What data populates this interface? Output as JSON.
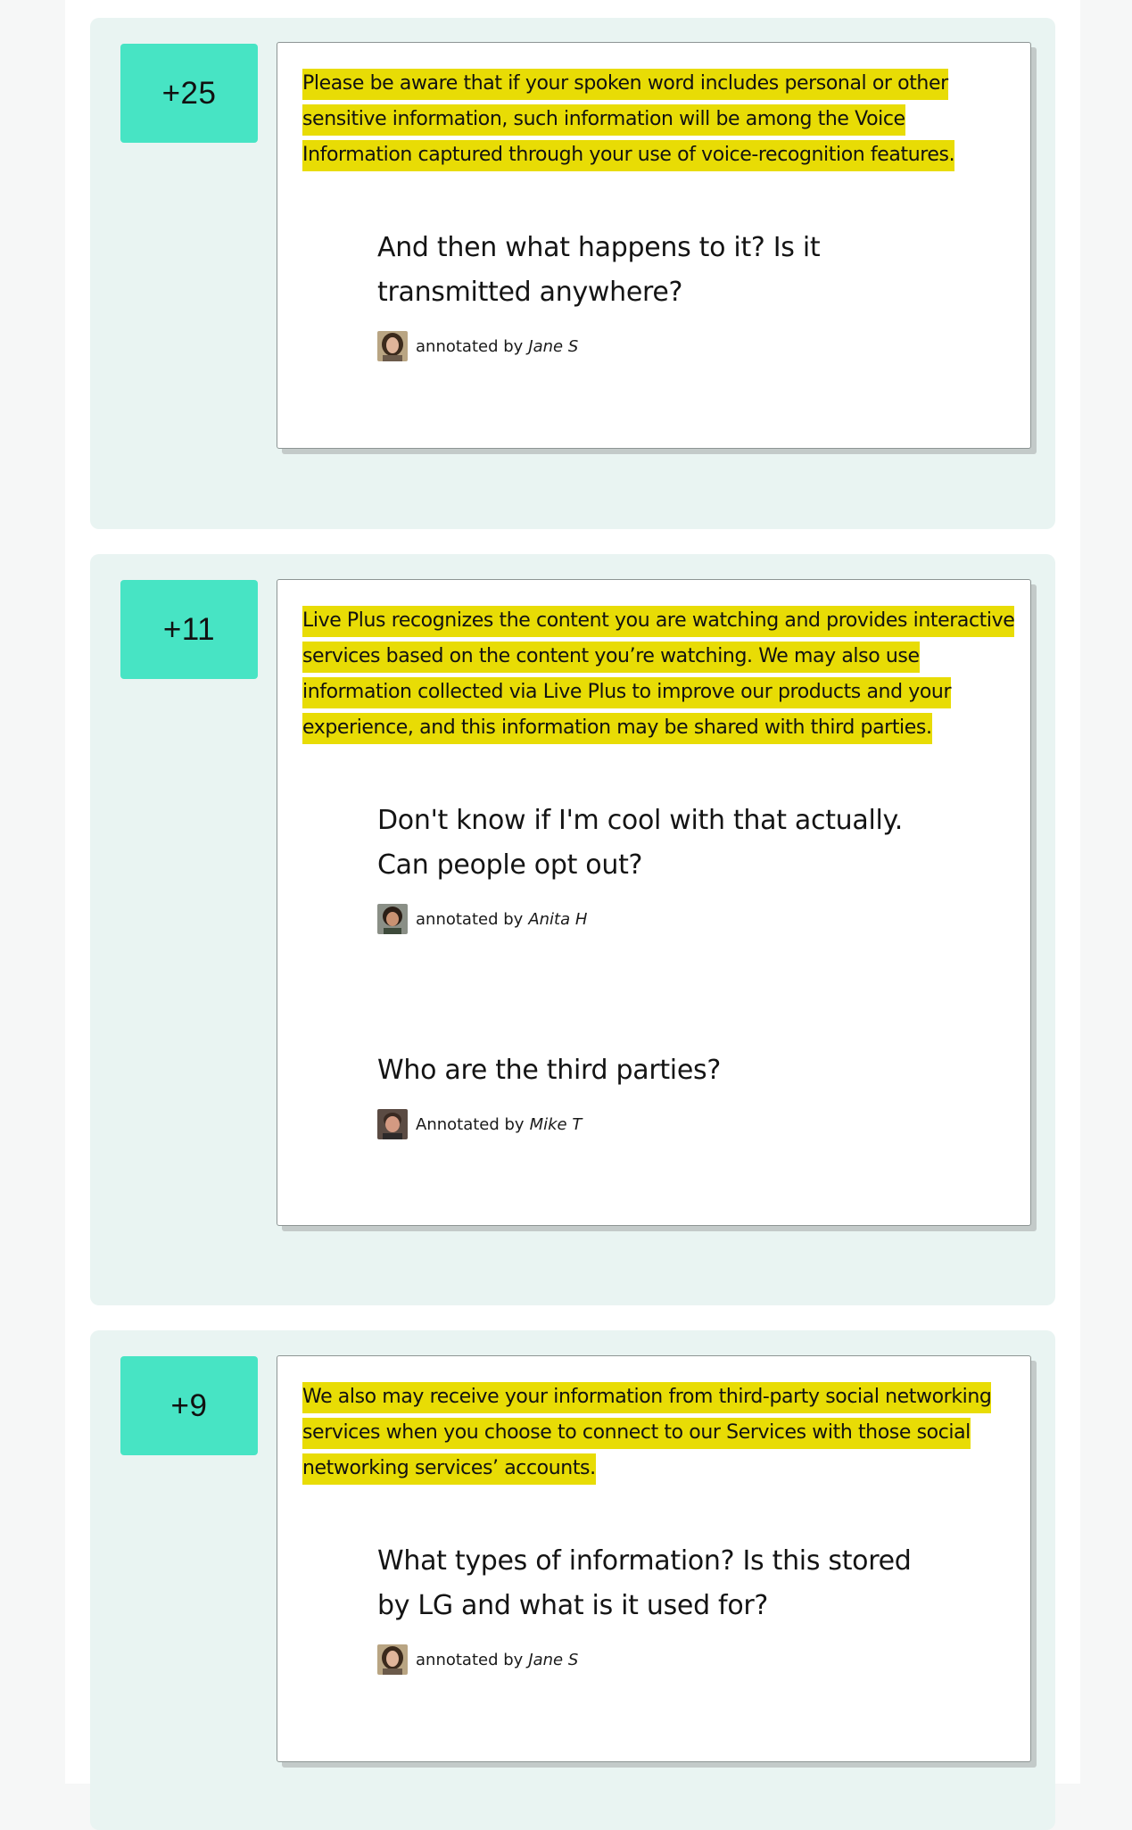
{
  "annotations": [
    {
      "score": "+25",
      "quote": "Please be aware that if your spoken word includes personal or other sensitive information, such information will be among the Voice Information captured through your use of voice-recognition features.",
      "notes": [
        {
          "text": "And then what happens to it? Is it transmitted anywhere?",
          "by_label": "annotated by",
          "author": "Jane S",
          "avatar": "avatar-jane"
        }
      ]
    },
    {
      "score": "+11",
      "quote": "Live Plus recognizes the content you are watching and provides interactive services based on the content you’re watching. We may also use information collected via Live Plus to improve our products and your experience, and this information may be shared with third parties.",
      "notes": [
        {
          "text": "Don't know if I'm cool with that actually. Can people opt out?",
          "by_label": "annotated by",
          "author": "Anita H",
          "avatar": "avatar-anita"
        },
        {
          "text": "Who are the third parties?",
          "by_label": "Annotated by",
          "author": "Mike T",
          "avatar": "avatar-mike"
        }
      ]
    },
    {
      "score": "+9",
      "quote": "We also may receive your information from third-party social networking services when you choose to connect to our Services with those social networking services’ accounts.",
      "notes": [
        {
          "text": "What types of information? Is this stored by LG and what is it used for?",
          "by_label": "annotated by",
          "author": "Jane S",
          "avatar": "avatar-jane"
        }
      ]
    }
  ],
  "colors": {
    "score_bg": "#47e4c4",
    "highlight": "#e8dc05",
    "group_bg": "#e9f4f2"
  }
}
